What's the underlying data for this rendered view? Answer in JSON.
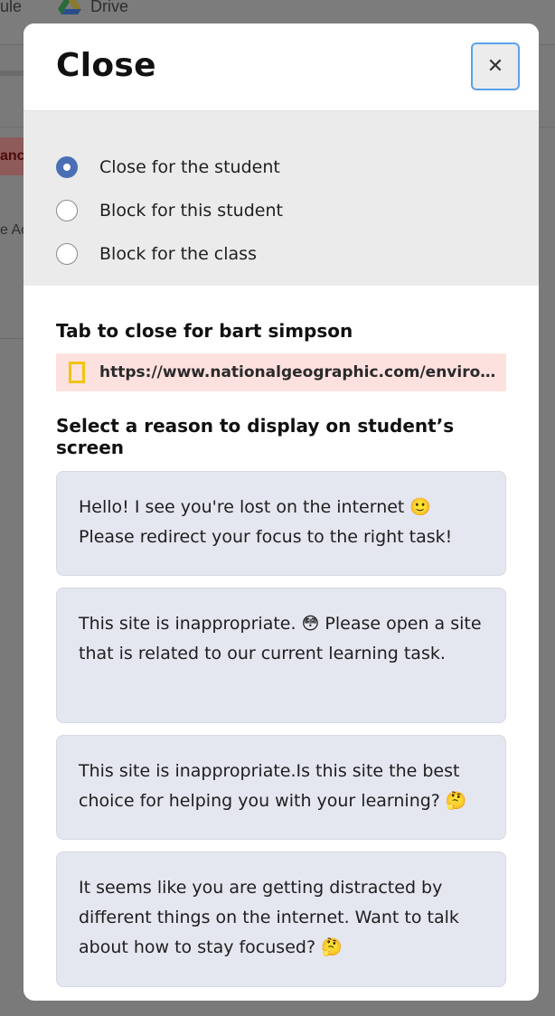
{
  "background": {
    "tab_fragment_1": "ule",
    "tab_drive": "Drive",
    "badge_fragment": "anc",
    "text_fragment": "e Ac"
  },
  "modal": {
    "title": "Close",
    "close_icon": "close-icon",
    "options": [
      {
        "label": "Close for the student",
        "selected": true
      },
      {
        "label": "Block for this student",
        "selected": false
      },
      {
        "label": "Block for the class",
        "selected": false
      }
    ],
    "tab_heading": "Tab to close for bart simpson",
    "tab_url": "https://www.nationalgeographic.com/environment/",
    "reasons_heading": "Select a reason to display on student’s screen",
    "reasons": [
      "Hello! I see you're lost on the internet 🙂 Please redirect your focus to the right task!",
      "This site is inappropriate. 😳 Please open a site that is related to our current learning task.",
      "This site is inappropriate.Is this site the best choice for helping you with your learning? 🤔",
      "It seems like you are getting distracted by different things on the internet. Want to talk about how to stay focused? 🤔"
    ]
  },
  "colors": {
    "accent": "#4a6fb5",
    "url_bg": "#fde1df",
    "card_bg": "#e4e6f0",
    "overlay": "#7a7a7a",
    "natgeo_yellow": "#f2c40f"
  }
}
